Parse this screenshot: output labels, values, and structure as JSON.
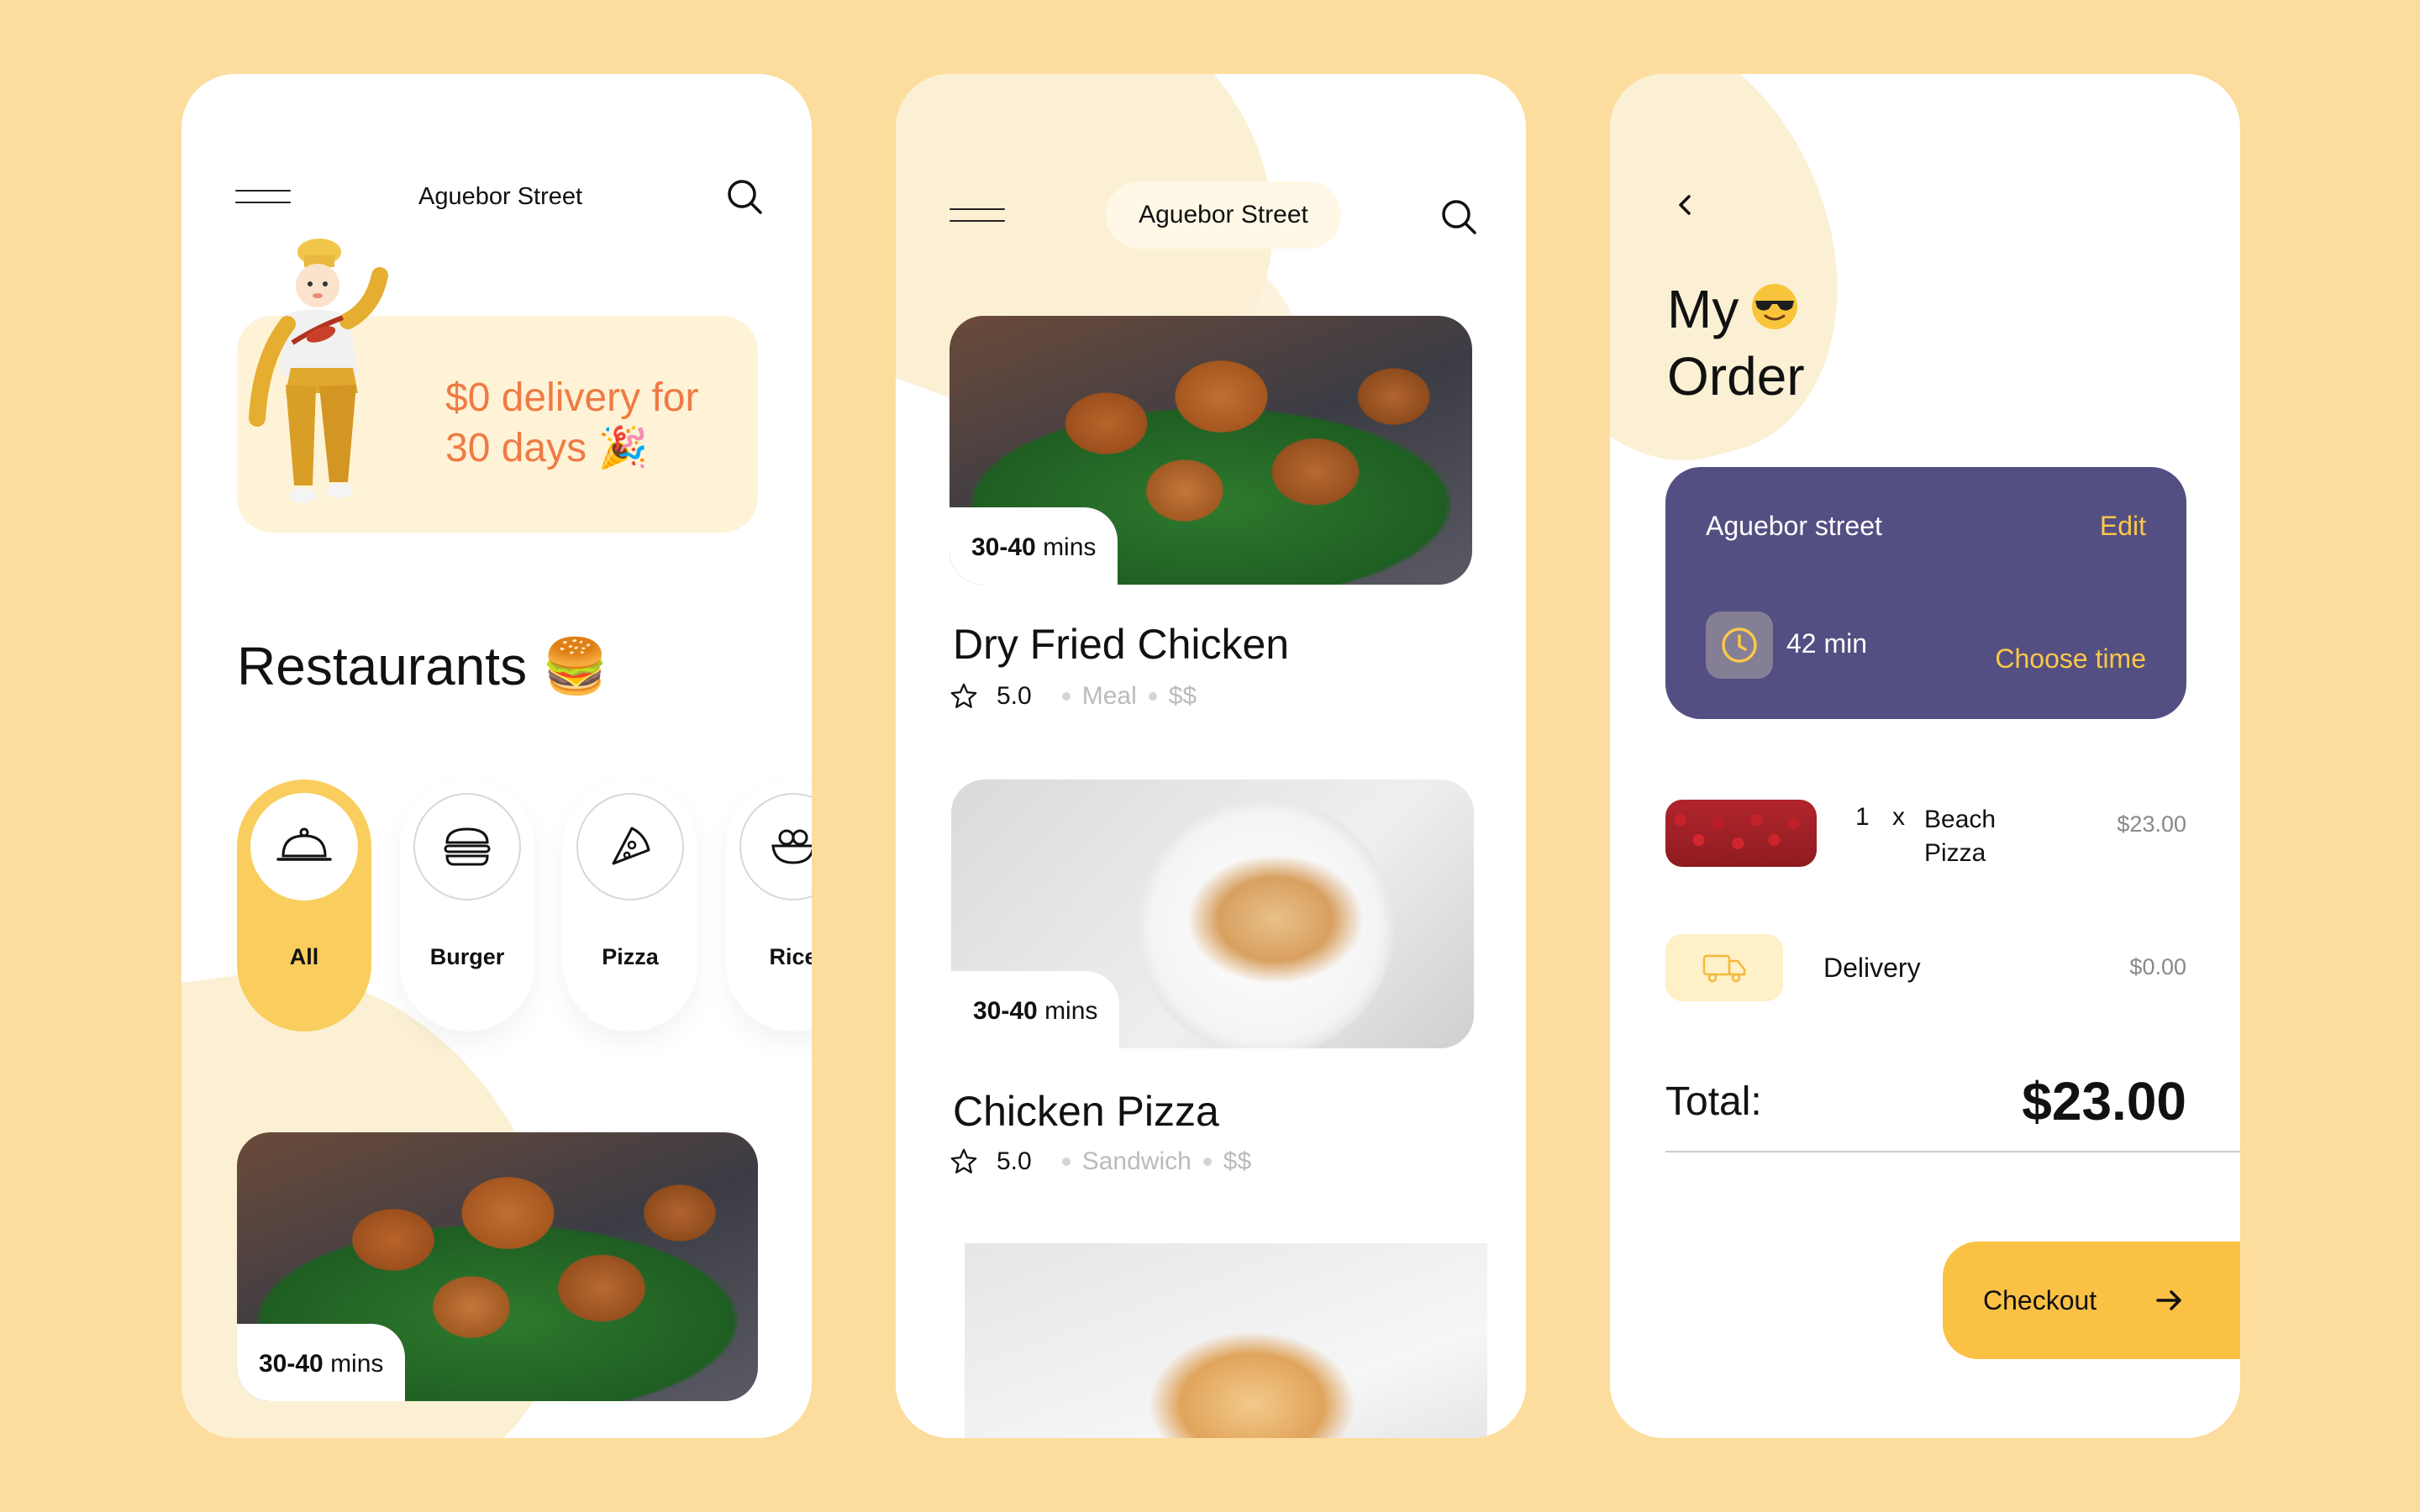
{
  "colors": {
    "background": "#FCDD9D",
    "accent_yellow": "#F9CE5E",
    "promo_orange": "#F07A45",
    "card_purple": "#544F82",
    "checkout_yellow": "#FBC145"
  },
  "screen1": {
    "street": "Aguebor Street",
    "promo_line1": "$0 delivery for",
    "promo_line2": "30 days 🎉",
    "section_title": "Restaurants 🍔",
    "categories": [
      {
        "label": "All",
        "icon": "cloche-icon",
        "active": true
      },
      {
        "label": "Burger",
        "icon": "burger-icon",
        "active": false
      },
      {
        "label": "Pizza",
        "icon": "pizza-icon",
        "active": false
      },
      {
        "label": "Rice",
        "icon": "rice-bowl-icon",
        "active": false
      }
    ],
    "featured": {
      "time_bold": "30-40",
      "time_unit": " mins"
    }
  },
  "screen2": {
    "street": "Aguebor Street",
    "dishes": [
      {
        "time_bold": "30-40",
        "time_unit": " mins",
        "name": "Dry Fried Chicken",
        "rating": "5.0",
        "category": "Meal",
        "price_level": "$$"
      },
      {
        "time_bold": "30-40",
        "time_unit": " mins",
        "name": "Chicken Pizza",
        "rating": "5.0",
        "category": "Sandwich",
        "price_level": "$$"
      }
    ]
  },
  "screen3": {
    "title_line1": "My",
    "title_line2": "Order",
    "address": "Aguebor street",
    "edit_label": "Edit",
    "eta": "42 min",
    "choose_time_label": "Choose time",
    "item": {
      "qty": "1",
      "times": "x",
      "name": "Beach Pizza",
      "price": "$23.00"
    },
    "delivery": {
      "label": "Delivery",
      "price": "$0.00"
    },
    "total_label": "Total:",
    "total_value": "$23.00",
    "checkout_label": "Checkout"
  }
}
